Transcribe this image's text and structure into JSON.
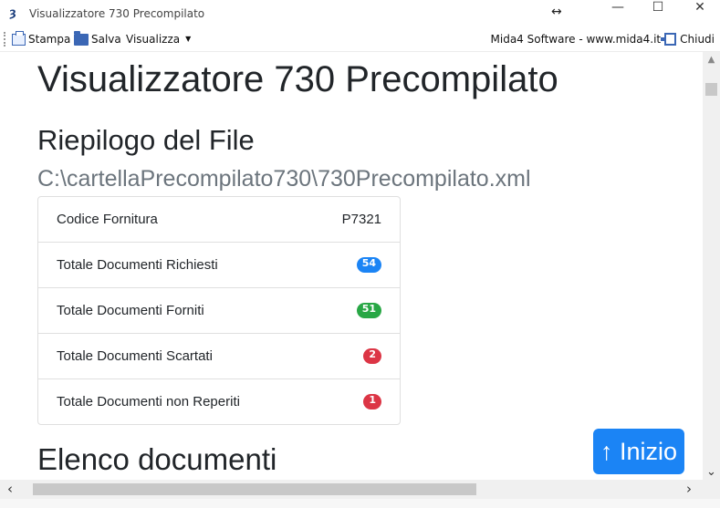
{
  "window": {
    "title": "Visualizzatore 730 Precompilato",
    "controls": {
      "minimize": "—",
      "maximize": "☐",
      "close": "✕"
    }
  },
  "toolbar": {
    "stampa": "Stampa",
    "salva": "Salva",
    "visualizza": "Visualizza",
    "site": "Mida4 Software - www.mida4.it",
    "chiudi": "Chiudi"
  },
  "page": {
    "title": "Visualizzatore 730 Precompilato",
    "summary_heading": "Riepilogo del File",
    "file_path": "C:\\cartellaPrecompilato730\\730Precompilato.xml",
    "section_heading": "Elenco documenti",
    "top_button": "↑ Inizio"
  },
  "summary": {
    "codice_label": "Codice Fornitura",
    "codice_value": "P7321",
    "rows": [
      {
        "label": "Totale Documenti Richiesti",
        "value": "54",
        "color": "#1b84f5"
      },
      {
        "label": "Totale Documenti Forniti",
        "value": "51",
        "color": "#28a745"
      },
      {
        "label": "Totale Documenti Scartati",
        "value": "2",
        "color": "#dc3545"
      },
      {
        "label": "Totale Documenti non Reperiti",
        "value": "1",
        "color": "#dc3545"
      }
    ]
  }
}
